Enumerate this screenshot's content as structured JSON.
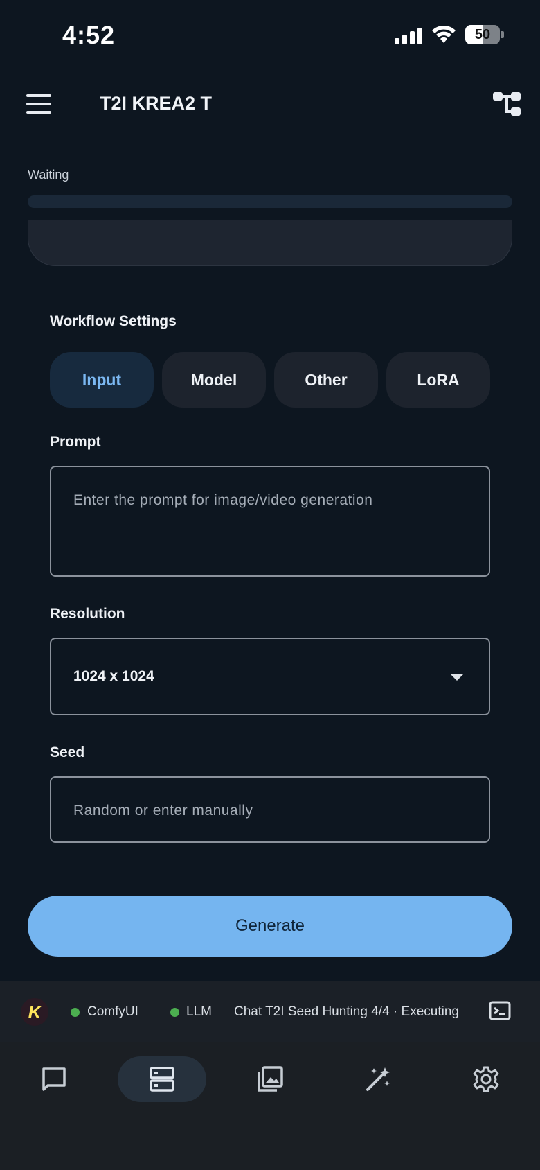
{
  "status_bar": {
    "time": "4:52",
    "battery_level": "50",
    "battery_fraction": 0.5
  },
  "app_bar": {
    "title": "T2I KREA2 T",
    "menu_icon": "hamburger-menu-icon",
    "right_icon": "workflow-tree-icon"
  },
  "progress": {
    "status": "Waiting",
    "fraction": 0.0
  },
  "workflow_settings": {
    "title": "Workflow Settings",
    "tabs": [
      {
        "label": "Input",
        "active": true
      },
      {
        "label": "Model",
        "active": false
      },
      {
        "label": "Other",
        "active": false
      },
      {
        "label": "LoRA",
        "active": false
      }
    ]
  },
  "fields": {
    "prompt": {
      "label": "Prompt",
      "value": "",
      "placeholder": "Enter the prompt for image/video generation"
    },
    "resolution": {
      "label": "Resolution",
      "selected": "1024 x 1024"
    },
    "seed": {
      "label": "Seed",
      "value": "",
      "placeholder": "Random or enter manually"
    }
  },
  "generate_label": "Generate",
  "status_strip": {
    "logo_letter": "K",
    "service_1": "ComfyUI",
    "service_2": "LLM",
    "message": "Chat T2I Seed Hunting 4/4 · Executing",
    "status_color": "#4caf50"
  },
  "bottom_nav": {
    "items": [
      {
        "icon": "chat-icon",
        "active": false
      },
      {
        "icon": "server-icon",
        "active": true
      },
      {
        "icon": "gallery-icon",
        "active": false
      },
      {
        "icon": "magic-wand-icon",
        "active": false
      },
      {
        "icon": "settings-gear-icon",
        "active": false
      }
    ]
  },
  "colors": {
    "background": "#0d1620",
    "accent": "#75b5f0",
    "active_tab_text": "#7bb8f2"
  }
}
